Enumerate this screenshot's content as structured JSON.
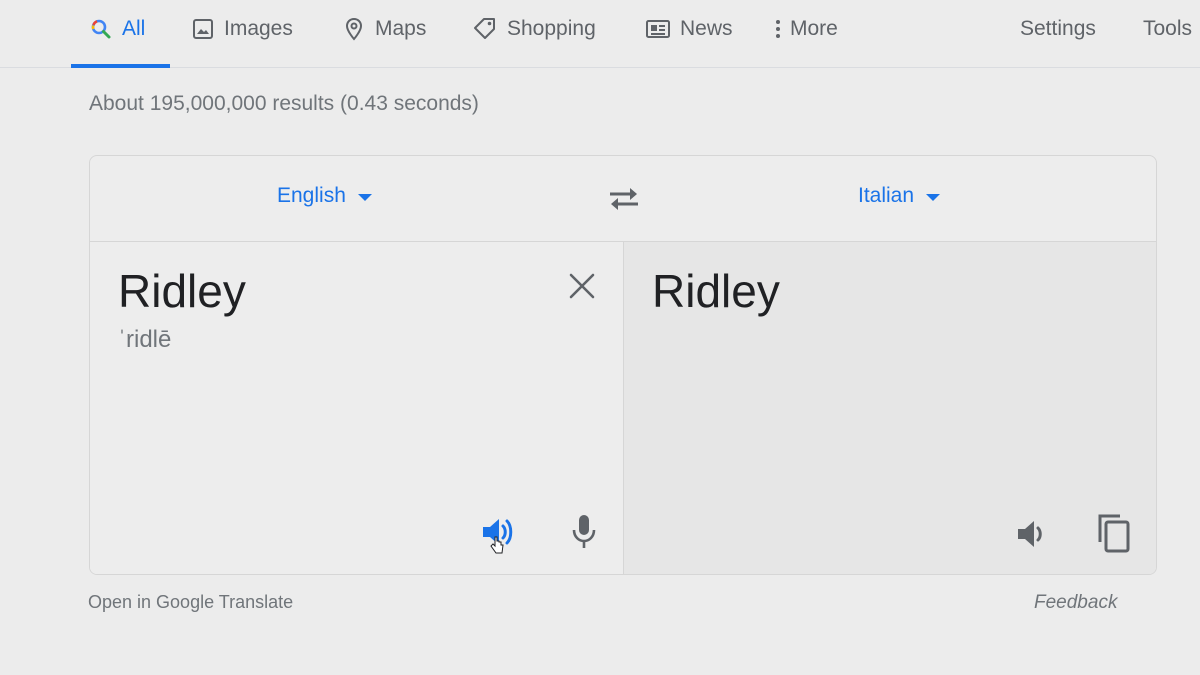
{
  "nav": {
    "tabs": [
      {
        "label": "All",
        "icon": "search-icon",
        "active": true
      },
      {
        "label": "Images",
        "icon": "image-icon",
        "active": false
      },
      {
        "label": "Maps",
        "icon": "map-pin-icon",
        "active": false
      },
      {
        "label": "Shopping",
        "icon": "tag-icon",
        "active": false
      },
      {
        "label": "News",
        "icon": "newspaper-icon",
        "active": false
      },
      {
        "label": "More",
        "icon": "more-vert-icon",
        "active": false
      }
    ],
    "settings_label": "Settings",
    "tools_label": "Tools"
  },
  "stats": "About 195,000,000 results (0.43 seconds)",
  "translate": {
    "source_lang": "English",
    "target_lang": "Italian",
    "source_text": "Ridley",
    "source_phonetic": "ˈridlē",
    "target_text": "Ridley"
  },
  "footer": {
    "open_link": "Open in Google Translate",
    "feedback": "Feedback"
  },
  "colors": {
    "accent": "#1a73e8",
    "text": "#202124",
    "muted": "#70757a",
    "icon": "#5f6368",
    "background": "#ececec"
  }
}
